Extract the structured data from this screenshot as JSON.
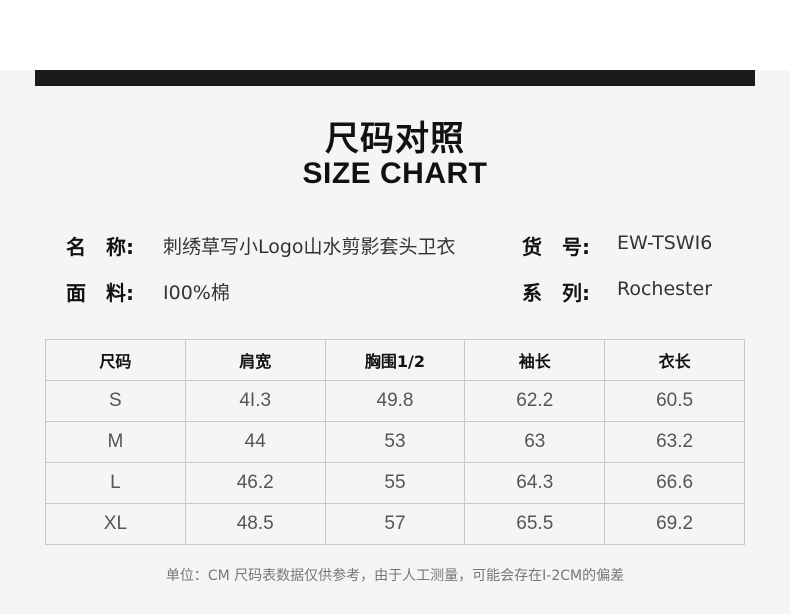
{
  "title_cn": "尺码对照",
  "title_en": "SIZE CHART",
  "info": {
    "name_label": "名　称:",
    "name_value": "刺绣草写小Logo山水剪影套头卫衣",
    "sku_label": "货　号:",
    "sku_value": "EW-TSWI6",
    "fabric_label": "面　料:",
    "fabric_value": "I00%棉",
    "series_label": "系　列:",
    "series_value": "Rochester"
  },
  "table": {
    "headers": [
      "尺码",
      "肩宽",
      "胸围1/2",
      "袖长",
      "衣长"
    ],
    "rows": [
      [
        "S",
        "4I.3",
        "49.8",
        "62.2",
        "60.5"
      ],
      [
        "M",
        "44",
        "53",
        "63",
        "63.2"
      ],
      [
        "L",
        "46.2",
        "55",
        "64.3",
        "66.6"
      ],
      [
        "XL",
        "48.5",
        "57",
        "65.5",
        "69.2"
      ]
    ]
  },
  "footnote": "单位：CM 尺码表数据仅供参考，由于人工测量，可能会存在I-2CM的偏差"
}
